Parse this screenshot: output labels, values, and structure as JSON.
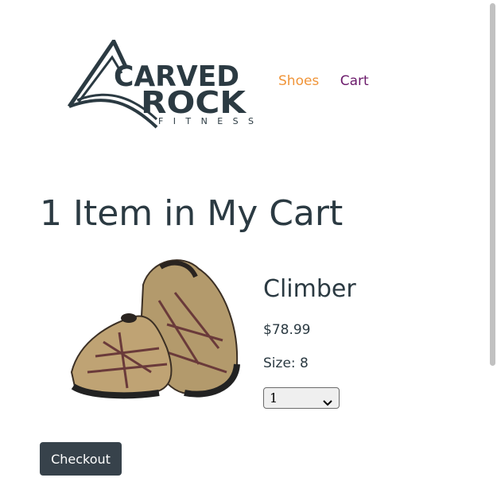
{
  "brand": {
    "logo_line1": "CARVED",
    "logo_line2": "ROCK",
    "logo_line3": "FITNESS"
  },
  "nav": {
    "items": [
      {
        "label": "Shoes",
        "color": "#f0953a"
      },
      {
        "label": "Cart",
        "color": "#6b1a6b"
      }
    ]
  },
  "cart": {
    "title": "1 Item in My Cart",
    "item": {
      "name": "Climber",
      "price": "$78.99",
      "size_label": "Size: 8",
      "quantity": "1"
    },
    "checkout_label": "Checkout"
  },
  "colors": {
    "text": "#2b3a42",
    "button_bg": "#37424b"
  }
}
